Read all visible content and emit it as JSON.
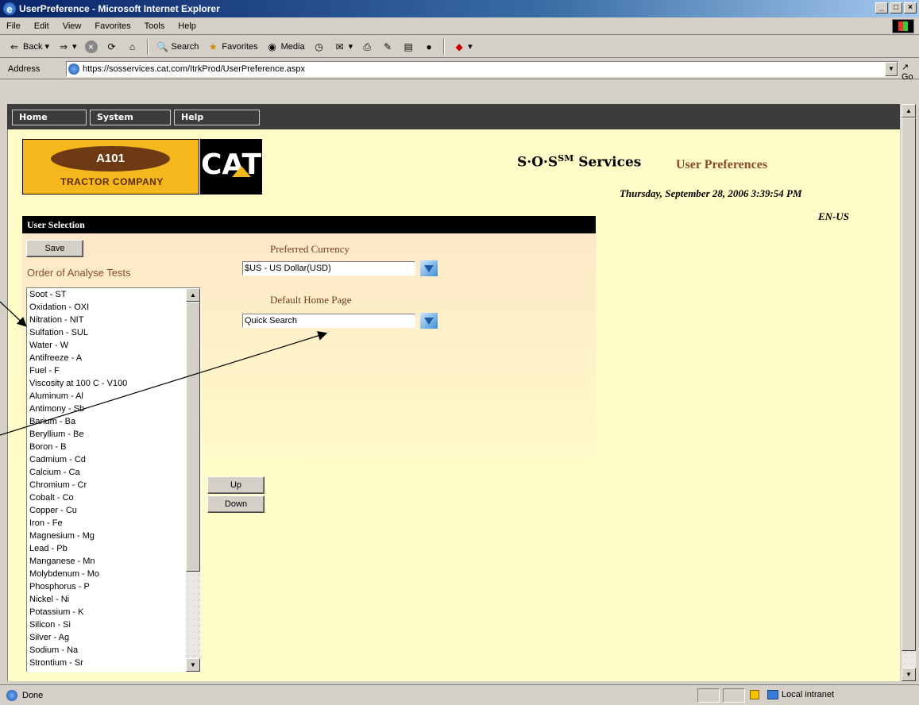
{
  "window": {
    "title": "UserPreference - Microsoft Internet Explorer",
    "min": "_",
    "max": "□",
    "close": "×"
  },
  "menu": {
    "file": "File",
    "edit": "Edit",
    "view": "View",
    "favorites": "Favorites",
    "tools": "Tools",
    "help": "Help"
  },
  "toolbar": {
    "back": "Back",
    "search": "Search",
    "favorites": "Favorites",
    "media": "Media"
  },
  "address": {
    "label": "Address",
    "url": "https://sosservices.cat.com/ItrkProd/UserPreference.aspx",
    "go": "Go"
  },
  "nav": {
    "home": "Home",
    "system": "System",
    "help": "Help"
  },
  "logo": {
    "dealer_name": "A101",
    "dealer_sub": "TRACTOR COMPANY",
    "brand": "CAT"
  },
  "header": {
    "service_prefix": "S·O·S",
    "service_sup": "SM",
    "service_suffix": " Services",
    "page_title": "User Preferences",
    "datetime": "Thursday, September 28, 2006 3:39:54 PM",
    "locale": "EN-US"
  },
  "panel": {
    "title": "User Selection",
    "save": "Save",
    "order_label": "Order of Analyse Tests",
    "tests": [
      "Soot - ST",
      "Oxidation - OXI",
      "Nitration - NIT",
      "Sulfation - SUL",
      "Water - W",
      "Antifreeze - A",
      "Fuel - F",
      "Viscosity at 100 C - V100",
      "Aluminum - Al",
      "Antimony - Sb",
      "Barium - Ba",
      "Beryllium - Be",
      "Boron - B",
      "Cadmium - Cd",
      "Calcium - Ca",
      "Chromium - Cr",
      "Cobalt - Co",
      "Copper - Cu",
      "Iron - Fe",
      "Magnesium - Mg",
      "Lead - Pb",
      "Manganese - Mn",
      "Molybdenum - Mo",
      "Phosphorus - P",
      "Nickel - Ni",
      "Potassium - K",
      "Silicon - Si",
      "Silver - Ag",
      "Sodium - Na",
      "Strontium - Sr"
    ],
    "currency_label": "Preferred Currency",
    "currency_value": "$US - US Dollar(USD)",
    "homepage_label": "Default Home Page",
    "homepage_value": "Quick Search",
    "up": "Up",
    "down": "Down"
  },
  "status": {
    "text": "Done",
    "zone": "Local intranet"
  },
  "colors": {
    "title_bar": "#0a246a",
    "page_bg": "#fffcc7",
    "accent": "#8b4c2a",
    "dealer_yellow": "#f5b81c"
  }
}
